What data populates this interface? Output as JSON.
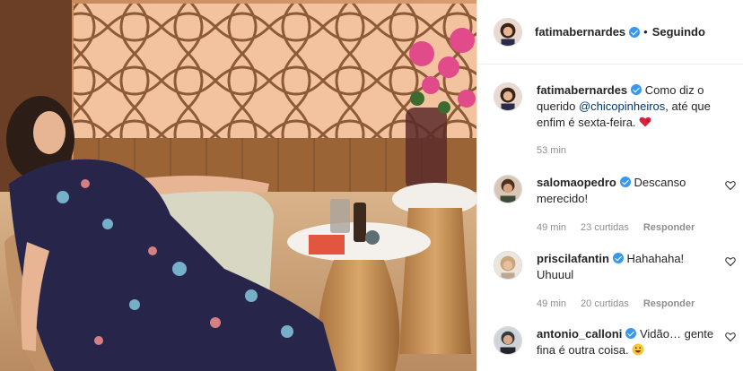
{
  "post": {
    "author": "fatimabernardes",
    "follow_state": "Seguindo",
    "separator": "•",
    "caption": {
      "author": "fatimabernardes",
      "text_before": "Como diz o querido ",
      "mention": "@chicopinheiros",
      "text_after": ", até que enfim é sexta-feira. ",
      "emoji": "heart-icon",
      "time": "53 min"
    }
  },
  "comments": [
    {
      "user": "salomaopedro",
      "text": "Descanso merecido!",
      "time": "49 min",
      "likes": "23 curtidas",
      "reply": "Responder"
    },
    {
      "user": "priscilafantin",
      "text": "Hahahaha! Uhuuul",
      "time": "49 min",
      "likes": "20 curtidas",
      "reply": "Responder"
    },
    {
      "user": "antonio_calloni",
      "text": "Vidão… gente fina é outra coisa. ",
      "emoji": "grinning-face-emoji"
    }
  ],
  "colors": {
    "accent": "#3897f0",
    "mention": "#00376b",
    "muted": "#8e8e8e",
    "text": "#262626"
  }
}
